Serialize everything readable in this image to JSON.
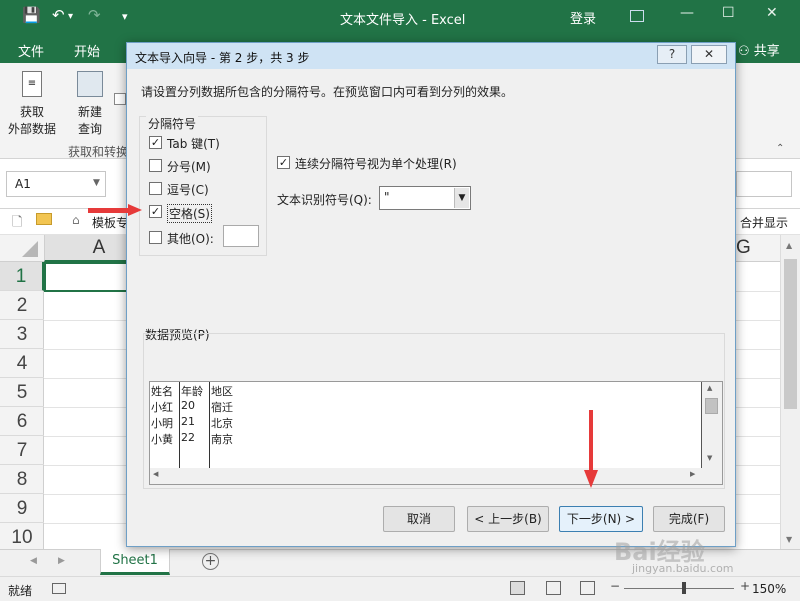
{
  "titlebar": {
    "title": "文本文件导入 - Excel",
    "login": "登录",
    "share": "共享"
  },
  "ribbon_tabs": [
    "文件",
    "开始"
  ],
  "ribbon": {
    "get_external_line1": "获取",
    "get_external_line2": "外部数据",
    "new_query_line1": "新建",
    "new_query_line2": "查询",
    "group_label": "获取和转换"
  },
  "namebox": "A1",
  "favbar": {
    "template": "模板专",
    "merge": "合并显示"
  },
  "columns": {
    "A": "A",
    "G": "G"
  },
  "rows": [
    "1",
    "2",
    "3",
    "4",
    "5",
    "6",
    "7",
    "8",
    "9",
    "10"
  ],
  "sheet": {
    "tab": "Sheet1"
  },
  "status": {
    "ready": "就绪",
    "zoom": "150%"
  },
  "dialog": {
    "title": "文本导入向导 - 第 2 步，共 3 步",
    "help": "?",
    "close": "✕",
    "intro": "请设置分列数据所包含的分隔符号。在预览窗口内可看到分列的效果。",
    "delim_group": "分隔符号",
    "tab": "Tab 键(T)",
    "semicolon": "分号(M)",
    "comma": "逗号(C)",
    "space": "空格(S)",
    "other": "其他(O):",
    "consecutive": "连续分隔符号视为单个处理(R)",
    "qualifier_label": "文本识别符号(Q):",
    "qualifier_value": "\"",
    "preview_label": "数据预览(P)",
    "preview_rows": [
      [
        "姓名",
        "年龄",
        "地区"
      ],
      [
        "小红",
        "20",
        "宿迁"
      ],
      [
        "小明",
        "21",
        "北京"
      ],
      [
        "小黄",
        "22",
        "南京"
      ]
    ],
    "cancel": "取消",
    "back": "< 上一步(B)",
    "next": "下一步(N) >",
    "finish": "完成(F)"
  },
  "watermark": {
    "brand": "Bai经验",
    "url": "jingyan.baidu.com"
  }
}
